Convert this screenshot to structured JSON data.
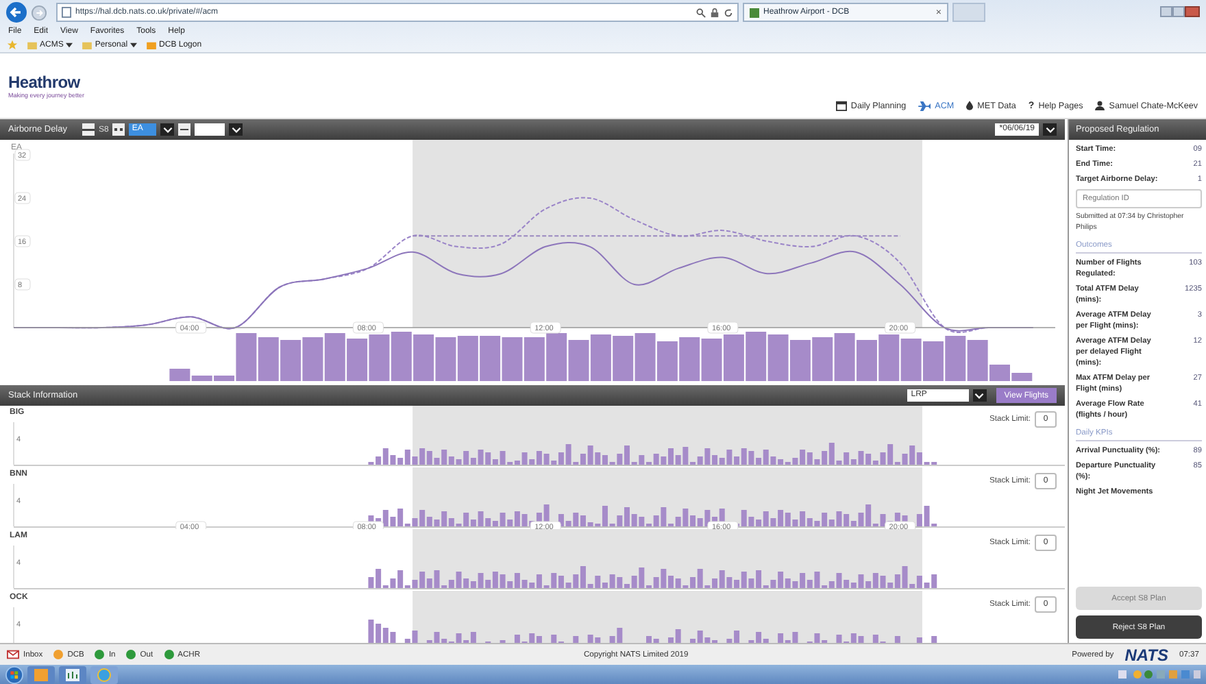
{
  "browser": {
    "url": "https://hal.dcb.nats.co.uk/private/#/acm",
    "tab": {
      "title": "Heathrow Airport - DCB",
      "close": "×"
    },
    "menu": [
      "File",
      "Edit",
      "View",
      "Favorites",
      "Tools",
      "Help"
    ],
    "favorites": [
      {
        "label": "ACMS",
        "dropdown": true
      },
      {
        "label": "Personal",
        "dropdown": true
      },
      {
        "label": "DCB Logon",
        "dropdown": false
      }
    ]
  },
  "header": {
    "logo": "Heathrow",
    "tagline": "Making every journey better",
    "nav": [
      {
        "label": "Daily Planning",
        "selected": false
      },
      {
        "label": "ACM",
        "selected": true
      },
      {
        "label": "MET Data",
        "selected": false
      },
      {
        "glyph": "?",
        "label": "Help Pages",
        "selected": false
      },
      {
        "label": "Samuel Chate-McKeev",
        "selected": false
      }
    ]
  },
  "airborne_delay": {
    "title": "Airborne Delay",
    "plan": "S8",
    "measure": "EA",
    "measure_selected": true,
    "date": "*06/06/19",
    "chart_data": {
      "type": "line",
      "ylabel": "EA",
      "x": [
        0,
        1,
        2,
        3,
        4,
        5,
        6,
        7,
        8,
        9,
        10,
        11,
        12,
        13,
        14,
        15,
        16,
        17,
        18,
        19,
        20,
        21,
        22,
        23
      ],
      "xlim": [
        0,
        23.5
      ],
      "ylim": [
        0,
        32
      ],
      "xticks": [
        {
          "value": 4,
          "label": "04:00"
        },
        {
          "value": 8,
          "label": "08:00"
        },
        {
          "value": 12,
          "label": "12:00"
        },
        {
          "value": 16,
          "label": "16:00"
        },
        {
          "value": 20,
          "label": "20:00"
        }
      ],
      "yticks": [
        8,
        16,
        24,
        32
      ],
      "series": [
        {
          "color": "#9a84c8",
          "line_style": "dashed",
          "values": [
            0,
            0,
            0,
            0.5,
            2,
            0,
            7.5,
            9,
            11,
            17,
            15,
            15.5,
            22,
            24,
            20,
            17,
            18,
            16,
            15,
            17,
            12,
            0,
            0,
            0
          ]
        },
        {
          "color": "#8d76bb",
          "line_style": "solid",
          "values": [
            0,
            0,
            0,
            0.5,
            2,
            0,
            7.5,
            9,
            11,
            14,
            10,
            10,
            15,
            15,
            8,
            11,
            13,
            10,
            12,
            14,
            8,
            0,
            0,
            0
          ]
        },
        {
          "color": "#9a88c0",
          "line_style": "dashed",
          "values": [
            null,
            null,
            null,
            null,
            null,
            null,
            null,
            null,
            null,
            17,
            17,
            17,
            17,
            17,
            17,
            17,
            17,
            17,
            17,
            17,
            17,
            null,
            null,
            null
          ]
        }
      ]
    }
  },
  "stack_information": {
    "title": "Stack Information",
    "select": "LRP",
    "button": "View Flights",
    "rows": [
      {
        "name": "BIG",
        "tick": "4",
        "limit_label": "Stack Limit:",
        "limit": "0"
      },
      {
        "name": "BNN",
        "tick": "4",
        "limit_label": "Stack Limit:",
        "limit": "0",
        "time_labels": [
          "04:00",
          "08:00",
          "12:00",
          "16:00",
          "20:00"
        ]
      },
      {
        "name": "LAM",
        "tick": "4",
        "limit_label": "Stack Limit:",
        "limit": "0"
      },
      {
        "name": "OCK",
        "tick": "4",
        "limit_label": "Stack Limit:",
        "limit": "0"
      }
    ]
  },
  "right_panel": {
    "title": "Proposed Regulation",
    "fields": [
      {
        "label": "Start Time:",
        "value": "09"
      },
      {
        "label": "End Time:",
        "value": "21"
      },
      {
        "label": "Target Airborne Delay:",
        "value": "1"
      }
    ],
    "regulation_id": {
      "placeholder": "Regulation ID"
    },
    "submitted": "Submitted at 07:34 by Christopher Philips",
    "sections": [
      {
        "title": "Outcomes",
        "rows": [
          {
            "label": "Number of Flights Regulated:",
            "value": "103"
          },
          {
            "label": "Total ATFM Delay (mins):",
            "value": "1235"
          },
          {
            "label": "Average ATFM Delay per Flight (mins):",
            "value": "3"
          },
          {
            "label": "Average ATFM Delay per delayed Flight (mins):",
            "value": "12"
          },
          {
            "label": "Max ATFM Delay per Flight (mins)",
            "value": "27"
          },
          {
            "label": "Average Flow Rate (flights / hour)",
            "value": "41"
          }
        ]
      },
      {
        "title": "Daily KPIs",
        "rows": [
          {
            "label": "Arrival Punctuality (%):",
            "value": "89"
          },
          {
            "label": "Departure Punctuality (%):",
            "value": "85"
          },
          {
            "label": "Night Jet Movements"
          }
        ]
      }
    ],
    "buttons": [
      {
        "label": "Accept S8 Plan",
        "disabled": true
      },
      {
        "label": "Reject S8 Plan",
        "disabled": false
      }
    ]
  },
  "footer": {
    "status": [
      {
        "kind": "mail",
        "label": "Inbox"
      },
      {
        "kind": "dot",
        "label": "DCB",
        "color": "#f0a030"
      },
      {
        "kind": "dot",
        "label": "In",
        "color": "#2e9a3c"
      },
      {
        "kind": "dot",
        "label": "Out",
        "color": "#2e9a3c"
      },
      {
        "kind": "dot",
        "label": "ACHR",
        "color": "#2e9a3c"
      }
    ],
    "copyright": "Copyright NATS Limited 2019",
    "powered_by": "Powered by",
    "brand": "NATS",
    "time": "07:37"
  }
}
